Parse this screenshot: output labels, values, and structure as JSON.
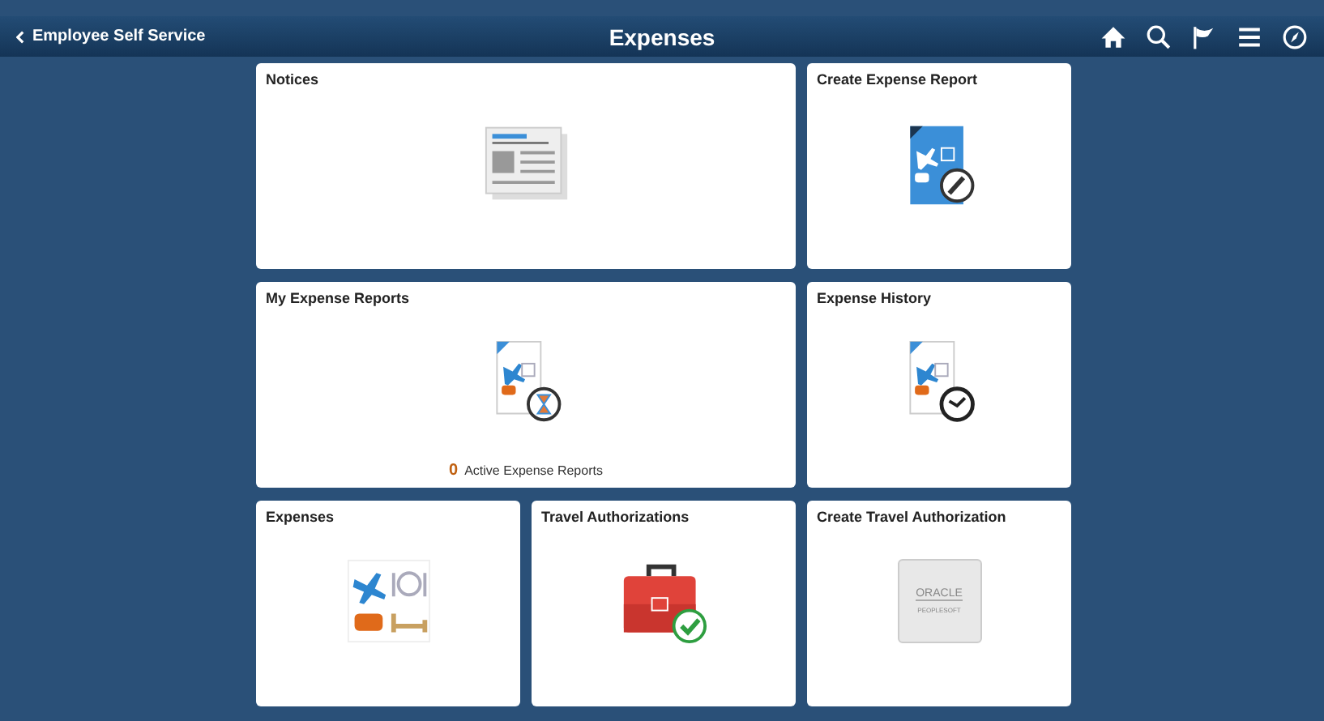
{
  "header": {
    "back_label": "Employee Self Service",
    "title": "Expenses"
  },
  "tile_rows": [
    [
      {
        "title": "Notices",
        "kind": "newspaper"
      },
      {
        "title": "Create Expense Report",
        "kind": "create-report"
      }
    ],
    [
      {
        "title": "My Expense Reports",
        "kind": "pending-report",
        "count": "0",
        "count_label": "Active Expense Reports"
      },
      {
        "title": "Expense History",
        "kind": "history-report"
      }
    ],
    [
      {
        "title": "Expenses",
        "kind": "expenses"
      },
      {
        "title": "Travel Authorizations",
        "kind": "briefcase"
      },
      {
        "title": "Create Travel Authorization",
        "kind": "logo",
        "logo_name": "ORACLE",
        "logo_sub": "PEOPLESOFT"
      }
    ]
  ]
}
